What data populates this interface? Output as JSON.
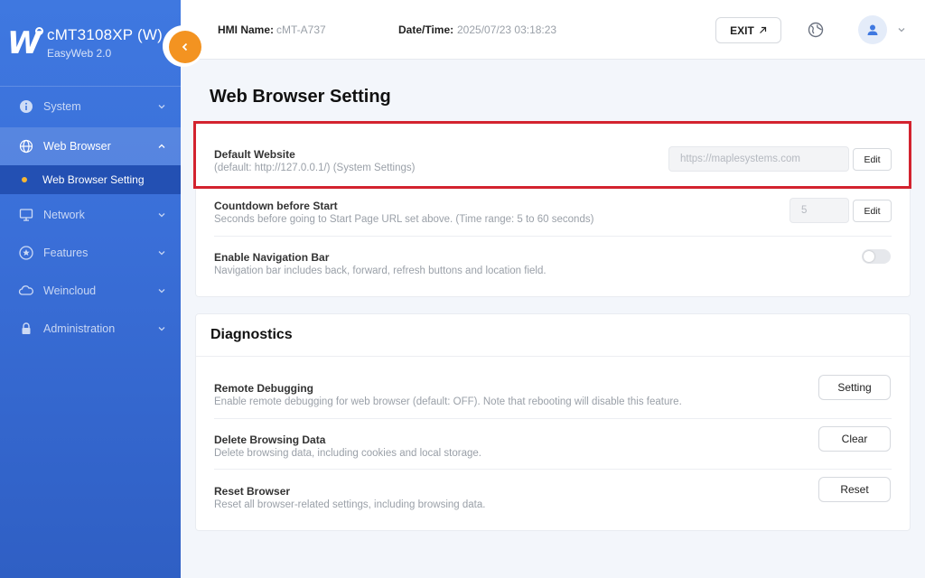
{
  "brand": {
    "name": "cMT3108XP (W)",
    "sub": "EasyWeb 2.0",
    "logo_letter": "W"
  },
  "sidebar": {
    "items": [
      {
        "label": "System",
        "icon": "info-icon"
      },
      {
        "label": "Web Browser",
        "icon": "globe-icon",
        "active": true
      },
      {
        "label": "Network",
        "icon": "monitor-icon"
      },
      {
        "label": "Features",
        "icon": "star-icon"
      },
      {
        "label": "Weincloud",
        "icon": "cloud-icon"
      },
      {
        "label": "Administration",
        "icon": "lock-icon"
      }
    ],
    "sub_item": "Web Browser Setting"
  },
  "header": {
    "hmi_label": "HMI Name:",
    "hmi_value": "cMT-A737",
    "datetime_label": "Date/Time:",
    "datetime_value": "2025/07/23 03:18:23",
    "exit_label": "EXIT"
  },
  "page": {
    "title": "Web Browser Setting"
  },
  "settings": {
    "default_website": {
      "title": "Default Website",
      "desc": "(default: http://127.0.0.1/) (System Settings)",
      "placeholder": "https://maplesystems.com",
      "button": "Edit"
    },
    "countdown": {
      "title": "Countdown before Start",
      "desc": "Seconds before going to Start Page URL set above. (Time range: 5 to 60 seconds)",
      "value": "5",
      "button": "Edit"
    },
    "nav_bar": {
      "title": "Enable Navigation Bar",
      "desc": "Navigation bar includes back, forward, refresh buttons and location field.",
      "enabled": false
    }
  },
  "diagnostics": {
    "title": "Diagnostics",
    "rows": [
      {
        "title": "Remote Debugging",
        "desc": "Enable remote debugging for web browser (default: OFF). Note that rebooting will disable this feature.",
        "button": "Setting"
      },
      {
        "title": "Delete Browsing Data",
        "desc": "Delete browsing data, including cookies and local storage.",
        "button": "Clear"
      },
      {
        "title": "Reset Browser",
        "desc": "Reset all browser-related settings, including browsing data.",
        "button": "Reset"
      }
    ]
  },
  "colors": {
    "sidebar": "#3a6fd8",
    "accent_orange": "#f39321",
    "highlight_red": "#d3232f",
    "sub_active": "#2350b3"
  }
}
